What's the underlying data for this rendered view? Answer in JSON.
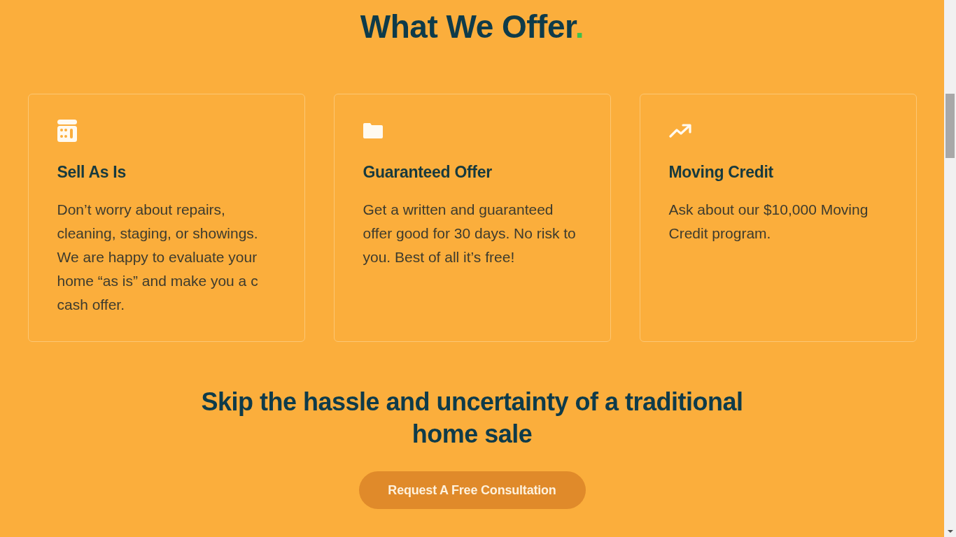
{
  "heading": {
    "text": "What We Offer",
    "accent": "."
  },
  "offers": [
    {
      "title": "Sell As Is",
      "text": "Don’t worry about repairs, cleaning, staging, or showings. We are happy to evaluate your home “as is” and make you a c cash offer."
    },
    {
      "title": "Guaranteed Offer",
      "text": "Get a written and guaranteed offer good for 30 days. No risk to you. Best of all it’s free!"
    },
    {
      "title": "Moving Credit",
      "text": "Ask about our $10,000 Moving Credit program."
    }
  ],
  "cta": {
    "heading": "Skip the hassle and uncertainty of a traditional home sale",
    "button": "Request A Free Consultation"
  }
}
